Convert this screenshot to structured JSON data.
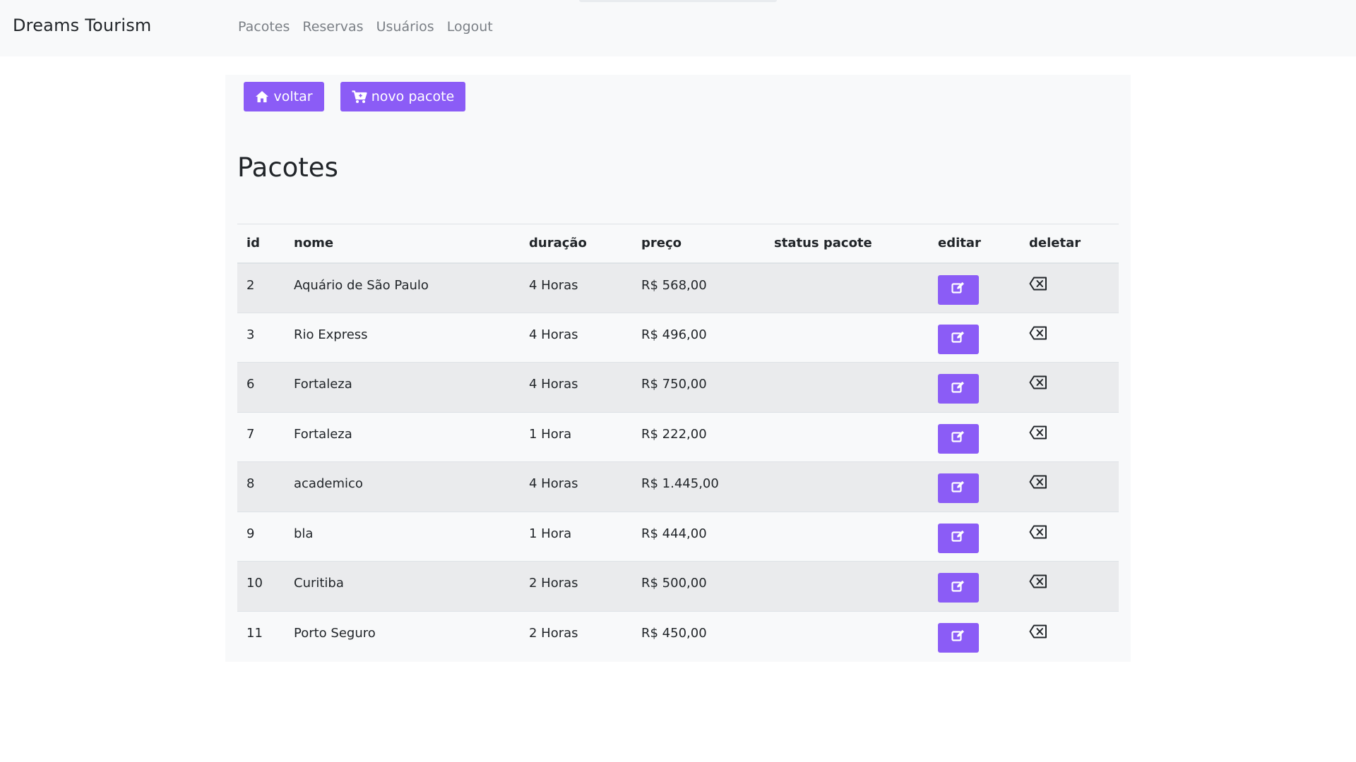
{
  "navbar": {
    "brand": "Dreams Tourism",
    "links": [
      "Pacotes",
      "Reservas",
      "Usuários",
      "Logout"
    ]
  },
  "toolbar": {
    "voltar_label": "voltar",
    "novo_pacote_label": "novo pacote",
    "voltar_icon": "home-icon",
    "novo_pacote_icon": "cart-plus-icon"
  },
  "page": {
    "title": "Pacotes"
  },
  "table": {
    "headers": [
      "id",
      "nome",
      "duração",
      "preço",
      "status pacote",
      "editar",
      "deletar"
    ],
    "rows": [
      {
        "id": "2",
        "nome": "Aquário de São Paulo",
        "duracao": "4 Horas",
        "preco": "R$ 568,00",
        "status": ""
      },
      {
        "id": "3",
        "nome": "Rio Express",
        "duracao": "4 Horas",
        "preco": "R$ 496,00",
        "status": ""
      },
      {
        "id": "6",
        "nome": "Fortaleza",
        "duracao": "4 Horas",
        "preco": "R$ 750,00",
        "status": ""
      },
      {
        "id": "7",
        "nome": "Fortaleza",
        "duracao": "1 Hora",
        "preco": "R$ 222,00",
        "status": ""
      },
      {
        "id": "8",
        "nome": "academico",
        "duracao": "4 Horas",
        "preco": "R$ 1.445,00",
        "status": ""
      },
      {
        "id": "9",
        "nome": "bla",
        "duracao": "1 Hora",
        "preco": "R$ 444,00",
        "status": ""
      },
      {
        "id": "10",
        "nome": "Curitiba",
        "duracao": "2 Horas",
        "preco": "R$ 500,00",
        "status": ""
      },
      {
        "id": "11",
        "nome": "Porto Seguro",
        "duracao": "2 Horas",
        "preco": "R$ 450,00",
        "status": ""
      }
    ],
    "edit_icon": "edit-icon",
    "delete_icon": "backspace-icon"
  },
  "colors": {
    "accent": "#8b5cf6",
    "navbar_bg": "#f8f9fa",
    "nav_link": "#7a7f85",
    "stripe": "#eaebed"
  }
}
